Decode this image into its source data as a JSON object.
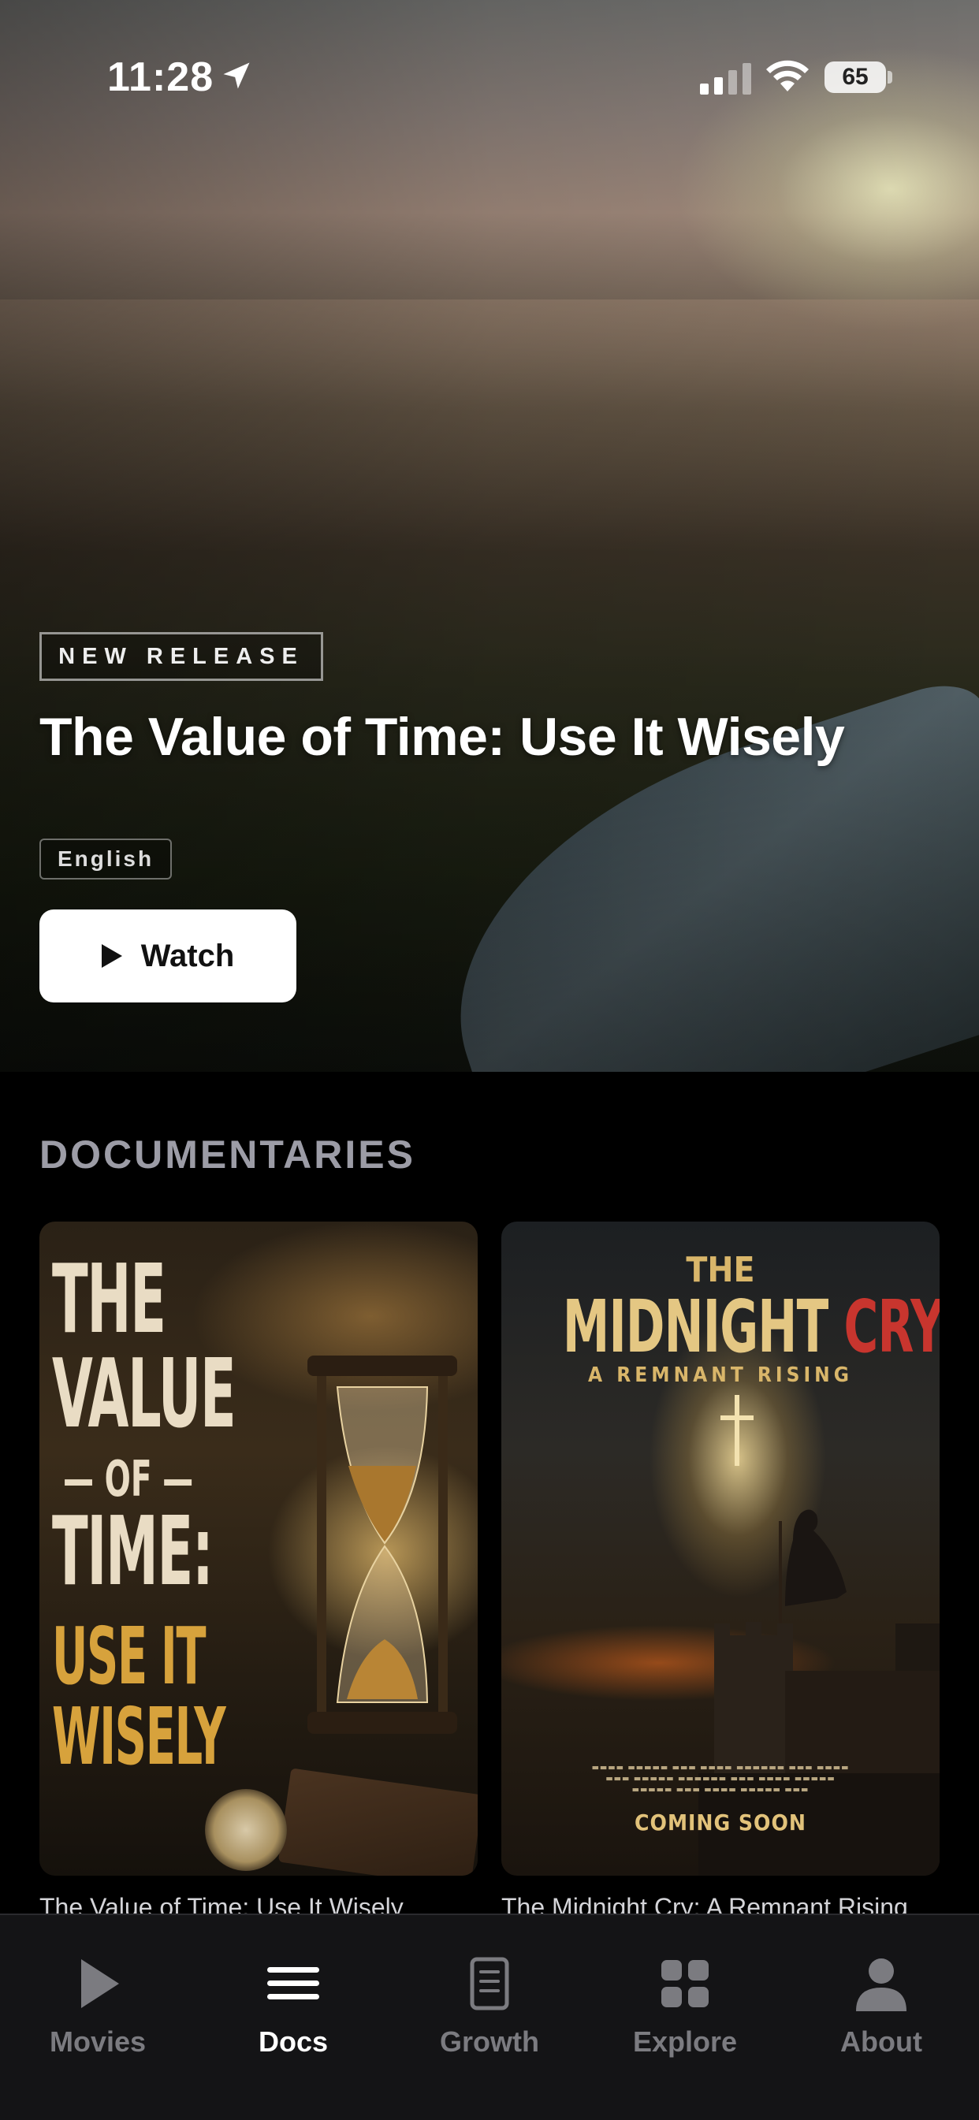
{
  "status_bar": {
    "time": "11:28",
    "battery": "65"
  },
  "hero": {
    "badge": "NEW RELEASE",
    "title": "The Value of Time: Use It Wisely",
    "language": "English",
    "watch_label": "Watch"
  },
  "section": {
    "title": "DOCUMENTARIES"
  },
  "cards": [
    {
      "caption": "The Value of Time: Use It Wisely",
      "poster": {
        "line1": "THE",
        "line2": "VALUE",
        "of": "— OF —",
        "line3": "TIME:",
        "line4": "USE IT",
        "line5": "WISELY"
      }
    },
    {
      "caption": "The Midnight Cry: A Remnant Rising",
      "poster": {
        "the": "THE",
        "title_a": "MIDNIGHT",
        "title_b": "CRY",
        "subtitle": "A REMNANT RISING",
        "coming_soon": "COMING SOON"
      }
    }
  ],
  "tabs": [
    {
      "label": "Movies",
      "icon": "play-icon",
      "active": false
    },
    {
      "label": "Docs",
      "icon": "list-icon",
      "active": true
    },
    {
      "label": "Growth",
      "icon": "document-icon",
      "active": false
    },
    {
      "label": "Explore",
      "icon": "grid-icon",
      "active": false
    },
    {
      "label": "About",
      "icon": "person-icon",
      "active": false
    }
  ]
}
